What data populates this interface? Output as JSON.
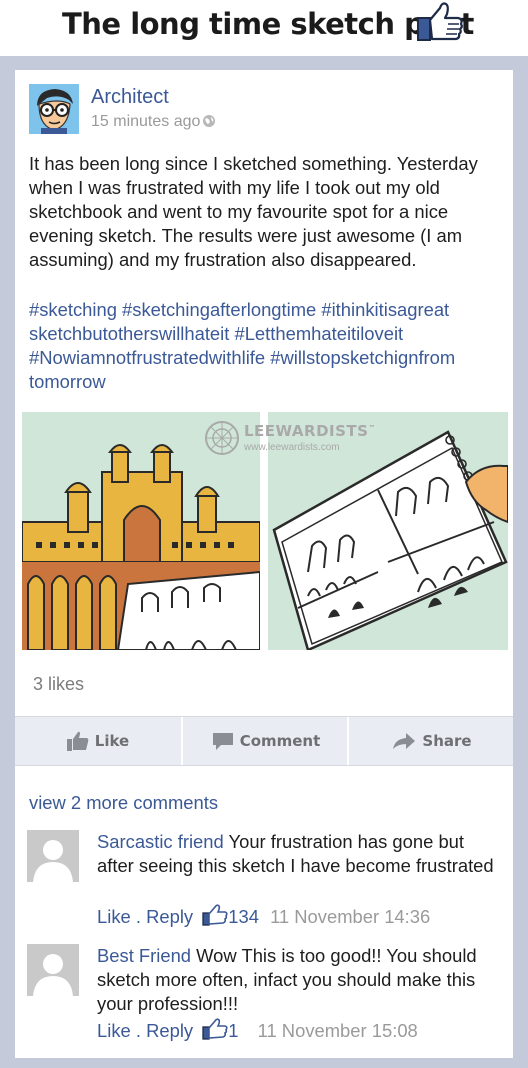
{
  "page_title": "The long time sketch post",
  "post": {
    "author": "Architect",
    "time": "15 minutes ago",
    "body": "It has been long since I sketched something. Yesterday when I was frustrated with my life I took out my old sketchbook and went to my favourite spot for a nice evening sketch. The results were just awesome (I am assuming) and my frustration also disappeared.",
    "hashtags": "#sketching #sketchingafterlongtime #ithinkitisagreat sketchbutotherswillhateit #Letthemhateitiloveit #Nowiamnotfrustratedwithlife #willstopsketchignfrom tomorrow",
    "watermark_name": "LEEWARDISTS",
    "watermark_tm": "™",
    "watermark_url": "www.leewardists.com",
    "likes": "3 likes"
  },
  "actions": {
    "like": "Like",
    "comment": "Comment",
    "share": "Share"
  },
  "comments": {
    "view_more": "view 2 more comments",
    "items": [
      {
        "name": "Sarcastic friend",
        "text": " Your frustration has gone but after seeing this sketch I have become frustrated",
        "like": "Like",
        "sep": " . ",
        "reply": "Reply",
        "count": "134",
        "date": "11 November 14:36"
      },
      {
        "name": "Best Friend",
        "text": " Wow This is too good!! You should sketch more often, infact you should make this your profession!!!",
        "like": "Like",
        "sep": " . ",
        "reply": "Reply",
        "count": "1",
        "date": "11 November 15:08"
      }
    ]
  },
  "colors": {
    "brand_blue": "#3b5997",
    "frame": "#c4cad9",
    "action_bar": "#e9ecf3"
  }
}
